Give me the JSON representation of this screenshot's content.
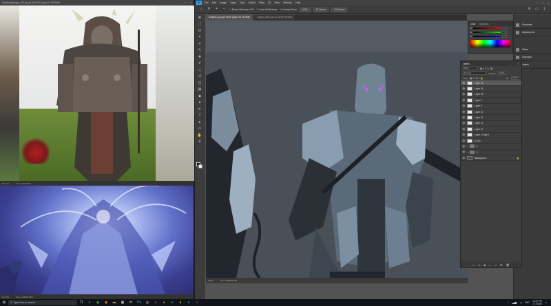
{
  "left_top": {
    "title": "fornblockdesign_002.jpg @ 66.67% (Layer 0, RGB/8)*",
    "status_zoom": "66.67%",
    "status_doc": "Doc: 2.6M/2.6M"
  },
  "left_bottom": {
    "status_zoom": "33.33%",
    "status_doc": "Doc: 6.08M/6.08M"
  },
  "photoshop": {
    "logo": "Ps",
    "menu": [
      "File",
      "Edit",
      "Image",
      "Layer",
      "Type",
      "Select",
      "Filter",
      "3D",
      "View",
      "Window",
      "Help"
    ],
    "options": {
      "resize_windows": "Resize Windows to Fit",
      "zoom_all_windows": "Zoom All Windows",
      "scrubby_zoom": "Scrubby Zoom",
      "zoom_level": "100%",
      "fit_screen": "Fit Screen",
      "fill_screen": "Fill Screen"
    },
    "tabs": [
      {
        "label": "Untitled-1.psd @ 100% (Layer 16, RGB/8)",
        "active": true
      },
      {
        "label": "Design_Refs.psd @ 33.3% (RGB/8)",
        "active": false
      }
    ],
    "status_zoom": "100%",
    "status_doc": "Doc: 6.08M/22.0M"
  },
  "color_panel": {
    "tabs": [
      "Color",
      "Swatches"
    ],
    "sliders": [
      {
        "label": "R",
        "value": "0"
      },
      {
        "label": "G",
        "value": "0"
      },
      {
        "label": "B",
        "value": "0"
      }
    ]
  },
  "dock": {
    "items": [
      "Properties",
      "Adjustments",
      "Paths",
      "Channels",
      "Layers"
    ]
  },
  "layers_panel": {
    "tabs": [
      "Layers"
    ],
    "kind_placeholder": "Kind",
    "blend_mode": "Normal",
    "opacity_label": "Opacity:",
    "opacity_value": "100%",
    "lock_label": "Lock:",
    "fill_label": "Fill:",
    "fill_value": "100%",
    "layers": [
      {
        "name": "Layer 16",
        "type": "layer",
        "selected": true
      },
      {
        "name": "Layer 15",
        "type": "layer",
        "selected": false
      },
      {
        "name": "Layer 14",
        "type": "layer",
        "selected": false
      },
      {
        "name": "Layer 9",
        "type": "layer",
        "selected": false
      },
      {
        "name": "Layer 8",
        "type": "layer",
        "selected": false
      },
      {
        "name": "Layer 10",
        "type": "layer",
        "selected": false
      },
      {
        "name": "Layer 11",
        "type": "layer",
        "selected": false
      },
      {
        "name": "Layer 12",
        "type": "layer",
        "selected": false
      },
      {
        "name": "Layer 17",
        "type": "layer",
        "selected": false
      },
      {
        "name": "Layer 1 copy 8",
        "type": "layer",
        "selected": false
      },
      {
        "name": "a Join",
        "type": "layer",
        "selected": false
      },
      {
        "name": "2",
        "type": "group",
        "selected": false
      },
      {
        "name": "1",
        "type": "group",
        "selected": false
      },
      {
        "name": "Background",
        "type": "background",
        "selected": false
      }
    ]
  },
  "taskbar": {
    "search_placeholder": "Type here to search",
    "tray_lang": "ENG",
    "time": "12:37 PM",
    "date": "7/17/2020"
  }
}
